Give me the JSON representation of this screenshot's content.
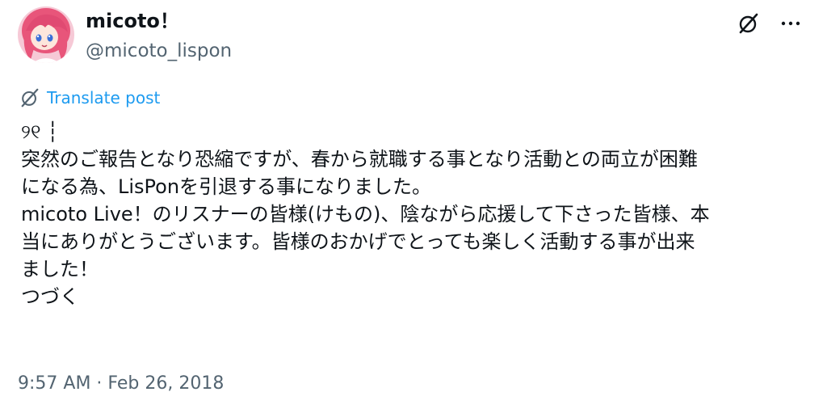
{
  "author": {
    "display_name": "micoto！",
    "handle": "@micoto_lispon"
  },
  "icons": {
    "avatar": "avatar-anime-character",
    "grok": "grok-icon",
    "more": "more-icon",
    "translate": "translate-icon"
  },
  "translate_label": "Translate post",
  "post_lines": [
    "୨୧ ┆",
    "突然のご報告となり恐縮ですが、春から就職する事となり活動との両立が困難",
    "になる為、LisPonを引退する事になりました。",
    "micoto Live！のリスナーの皆様(けもの)、陰ながら応援して下さった皆様、本",
    "当にありがとうございます。皆様のおかげでとっても楽しく活動する事が出来",
    "ました！",
    "つづく"
  ],
  "timestamp": "9:57 AM · Feb 26, 2018",
  "colors": {
    "text": "#0f1419",
    "secondary": "#536471",
    "link": "#1d9bf0",
    "avatar_hair": "#e8557a",
    "avatar_bg": "#f4b8c8"
  }
}
